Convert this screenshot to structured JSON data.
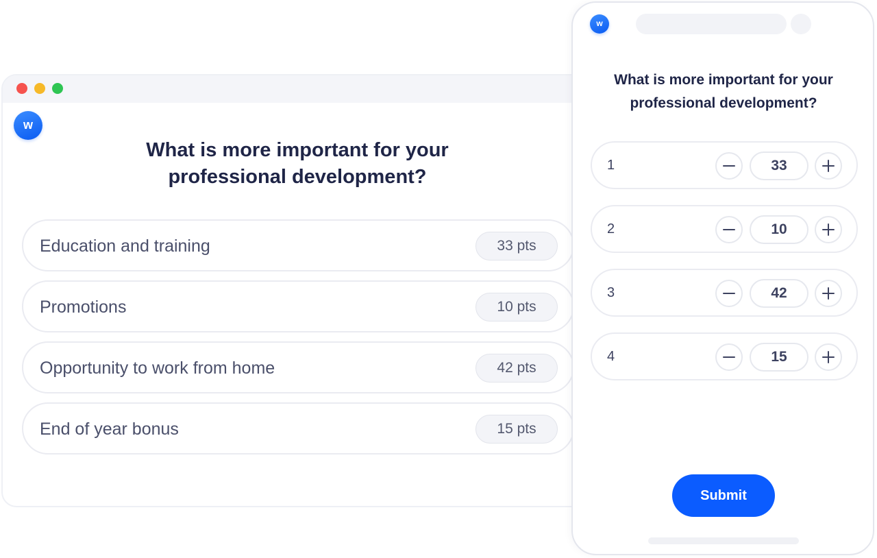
{
  "brand": {
    "logo_letter": "w",
    "accent": "#0b5cff"
  },
  "desktop": {
    "window_dots": [
      "red",
      "yellow",
      "green"
    ],
    "question": "What is more important for your professional development?",
    "options": [
      {
        "label": "Education and training",
        "points": "33 pts"
      },
      {
        "label": "Promotions",
        "points": "10 pts"
      },
      {
        "label": "Opportunity to work from home",
        "points": "42 pts"
      },
      {
        "label": "End of year bonus",
        "points": "15 pts"
      }
    ]
  },
  "mobile": {
    "question": "What is more important for your professional development?",
    "rows": [
      {
        "number": "1",
        "value": "33"
      },
      {
        "number": "2",
        "value": "10"
      },
      {
        "number": "3",
        "value": "42"
      },
      {
        "number": "4",
        "value": "15"
      }
    ],
    "submit_label": "Submit"
  },
  "icons": {
    "decrement": "minus-icon",
    "increment": "plus-icon"
  }
}
